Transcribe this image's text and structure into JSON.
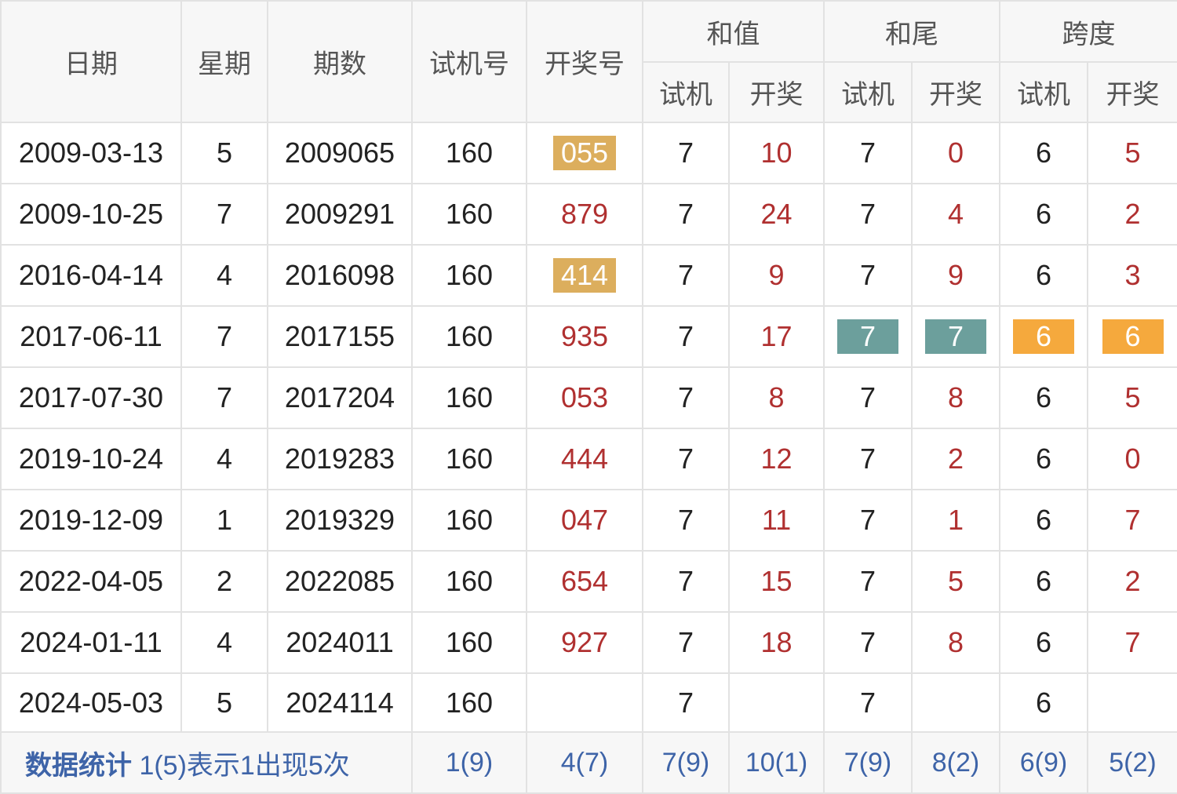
{
  "header": {
    "date": "日期",
    "weekday": "星期",
    "issue": "期数",
    "trial_number": "试机号",
    "draw_number": "开奖号",
    "sum_group": "和值",
    "tail_group": "和尾",
    "span_group": "跨度",
    "sub_trial": "试机",
    "sub_draw": "开奖"
  },
  "rows": [
    {
      "date": "2009-03-13",
      "weekday": "5",
      "issue": "2009065",
      "trial": "160",
      "draw": "055",
      "sum_trial": "7",
      "sum_draw": "10",
      "tail_trial": "7",
      "tail_draw": "0",
      "span_trial": "6",
      "span_draw": "5"
    },
    {
      "date": "2009-10-25",
      "weekday": "7",
      "issue": "2009291",
      "trial": "160",
      "draw": "879",
      "sum_trial": "7",
      "sum_draw": "24",
      "tail_trial": "7",
      "tail_draw": "4",
      "span_trial": "6",
      "span_draw": "2"
    },
    {
      "date": "2016-04-14",
      "weekday": "4",
      "issue": "2016098",
      "trial": "160",
      "draw": "414",
      "sum_trial": "7",
      "sum_draw": "9",
      "tail_trial": "7",
      "tail_draw": "9",
      "span_trial": "6",
      "span_draw": "3"
    },
    {
      "date": "2017-06-11",
      "weekday": "7",
      "issue": "2017155",
      "trial": "160",
      "draw": "935",
      "sum_trial": "7",
      "sum_draw": "17",
      "tail_trial": "7",
      "tail_draw": "7",
      "span_trial": "6",
      "span_draw": "6"
    },
    {
      "date": "2017-07-30",
      "weekday": "7",
      "issue": "2017204",
      "trial": "160",
      "draw": "053",
      "sum_trial": "7",
      "sum_draw": "8",
      "tail_trial": "7",
      "tail_draw": "8",
      "span_trial": "6",
      "span_draw": "5"
    },
    {
      "date": "2019-10-24",
      "weekday": "4",
      "issue": "2019283",
      "trial": "160",
      "draw": "444",
      "sum_trial": "7",
      "sum_draw": "12",
      "tail_trial": "7",
      "tail_draw": "2",
      "span_trial": "6",
      "span_draw": "0"
    },
    {
      "date": "2019-12-09",
      "weekday": "1",
      "issue": "2019329",
      "trial": "160",
      "draw": "047",
      "sum_trial": "7",
      "sum_draw": "11",
      "tail_trial": "7",
      "tail_draw": "1",
      "span_trial": "6",
      "span_draw": "7"
    },
    {
      "date": "2022-04-05",
      "weekday": "2",
      "issue": "2022085",
      "trial": "160",
      "draw": "654",
      "sum_trial": "7",
      "sum_draw": "15",
      "tail_trial": "7",
      "tail_draw": "5",
      "span_trial": "6",
      "span_draw": "2"
    },
    {
      "date": "2024-01-11",
      "weekday": "4",
      "issue": "2024011",
      "trial": "160",
      "draw": "927",
      "sum_trial": "7",
      "sum_draw": "18",
      "tail_trial": "7",
      "tail_draw": "8",
      "span_trial": "6",
      "span_draw": "7"
    },
    {
      "date": "2024-05-03",
      "weekday": "5",
      "issue": "2024114",
      "trial": "160",
      "draw": "",
      "sum_trial": "7",
      "sum_draw": "",
      "tail_trial": "7",
      "tail_draw": "",
      "span_trial": "6",
      "span_draw": ""
    }
  ],
  "stats": {
    "label_bold": "数据统计",
    "label_note": " 1(5)表示1出现5次",
    "trial": "1(9)",
    "draw": "4(7)",
    "sum_trial": "7(9)",
    "sum_draw": "10(1)",
    "tail_trial": "7(9)",
    "tail_draw": "8(2)",
    "span_trial": "6(9)",
    "span_draw": "5(2)"
  },
  "colors": {
    "highlight_gold": "#dcae5d",
    "highlight_teal": "#6c9f9c",
    "highlight_orange": "#f5a93d",
    "draw_text_red": "#b03030",
    "stats_text_blue": "#3e64a8"
  }
}
